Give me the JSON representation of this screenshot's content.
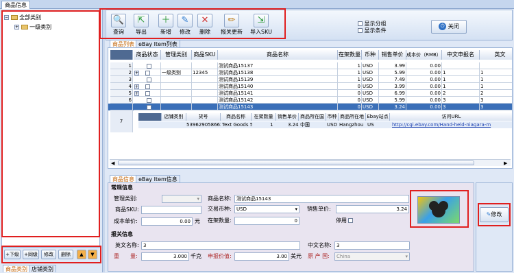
{
  "window_title": "商品信息",
  "tree": {
    "root": "全部类别",
    "child": "一级类别"
  },
  "left_buttons": {
    "down": "下级",
    "same": "同级",
    "edit": "修改",
    "del": "删除"
  },
  "left_tabs": {
    "t1": "商品类别",
    "t2": "店铺类别"
  },
  "toolbar": {
    "query": "查询",
    "export": "导出",
    "add": "新增",
    "edit": "修改",
    "delete": "删除",
    "customs": "报关更新",
    "import": "导入SKU"
  },
  "options": {
    "group": "显示分组",
    "cond": "显示条件"
  },
  "close_label": "关闭",
  "list_tabs": {
    "t1": "商品列表",
    "t2": "eBay Item列表"
  },
  "columns": [
    "商品状态",
    "管理类别",
    "商品SKU",
    "商品名称",
    "在架数量",
    "币种",
    "销售单价",
    "成本价（RMB）",
    "中文申报名",
    "英文"
  ],
  "rows": [
    {
      "n": "1",
      "plus": false,
      "cat": "",
      "sku": "",
      "name": "测试商品15137",
      "qty": "1",
      "cur": "USD",
      "price": "3.99",
      "cost": "0.00",
      "cn": "",
      "en": ""
    },
    {
      "n": "2",
      "plus": true,
      "cat": "一级类别",
      "sku": "12345",
      "name": "测试商品15138",
      "qty": "1",
      "cur": "USD",
      "price": "5.99",
      "cost": "0.00",
      "cn": "1",
      "en": "1"
    },
    {
      "n": "3",
      "plus": false,
      "cat": "",
      "sku": "",
      "name": "测试商品15139",
      "qty": "1",
      "cur": "USD",
      "price": "7.49",
      "cost": "0.00",
      "cn": "1",
      "en": "1"
    },
    {
      "n": "4",
      "plus": true,
      "cat": "",
      "sku": "",
      "name": "测试商品15140",
      "qty": "0",
      "cur": "USD",
      "price": "3.99",
      "cost": "0.00",
      "cn": "1",
      "en": "1"
    },
    {
      "n": "5",
      "plus": true,
      "cat": "",
      "sku": "",
      "name": "测试商品15141",
      "qty": "0",
      "cur": "USD",
      "price": "6.99",
      "cost": "0.00",
      "cn": "2",
      "en": "2"
    },
    {
      "n": "6",
      "plus": false,
      "cat": "",
      "sku": "",
      "name": "测试商品15142",
      "qty": "0",
      "cur": "USD",
      "price": "5.99",
      "cost": "0.00",
      "cn": "3",
      "en": "3"
    },
    {
      "n": "",
      "plus": false,
      "cat": "",
      "sku": "",
      "name": "测试商品15143",
      "qty": "0",
      "cur": "USD",
      "price": "3.24",
      "cost": "0.00",
      "cn": "3",
      "en": "3"
    }
  ],
  "sub_row_no": "7",
  "sub_columns": [
    "店铺类别",
    "货号",
    "商品名称",
    "在架数量",
    "销售单价",
    "商品所在国",
    "币种",
    "商品所在地",
    "Ebay站点",
    "访问URL"
  ],
  "sub_row": {
    "cat": "",
    "no": "5396290586620",
    "name": "Text Goods 5396",
    "qty": "1",
    "price": "3.24",
    "country": "中国",
    "cur": "USD",
    "loc": "Hangzhou",
    "site": "US",
    "url": "http://cgi.ebay.com/Hand-held-niagara-m"
  },
  "detail_tabs": {
    "t1": "商品信息",
    "t2": "eBay Item信息"
  },
  "general": {
    "title": "常规信息",
    "mgmt_cat": "管理类别:",
    "name_lbl": "商品名称:",
    "name_val": "测试商品15143",
    "sku_lbl": "商品SKU:",
    "cur_lbl": "交易币种:",
    "cur_val": "USD",
    "price_lbl": "销售单价:",
    "price_val": "3.24",
    "cost_lbl": "成本单价:",
    "cost_val": "0.00",
    "cost_unit": "元",
    "qty_lbl": "在架数量:",
    "qty_val": "0",
    "stop_lbl": "停用"
  },
  "customs": {
    "title": "报关信息",
    "en_lbl": "英文名称:",
    "en_val": "3",
    "cn_lbl": "中文名称:",
    "cn_val": "3",
    "weight_lbl": "重　　量:",
    "weight_val": "3.000",
    "weight_unit": "千克",
    "decl_lbl": "申报价值:",
    "decl_val": "3.00",
    "decl_unit": "美元",
    "origin_lbl": "原 产 国:",
    "origin_val": "China"
  },
  "edit_btn": "修改"
}
